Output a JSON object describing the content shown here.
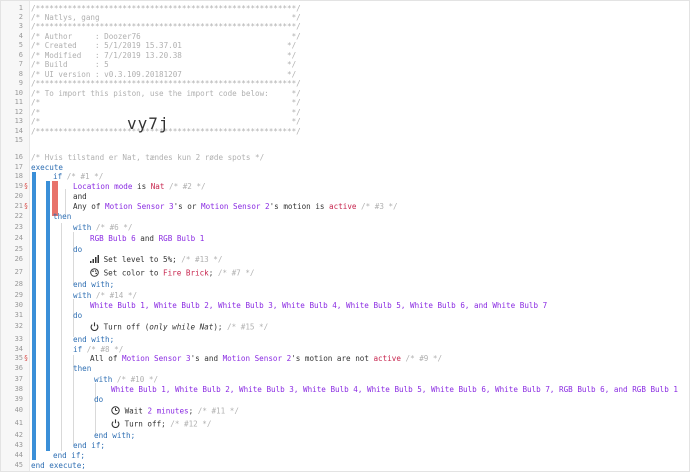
{
  "header": {
    "rule": "/*********************************************************/",
    "title": "/* Natlys, gang                                          */",
    "author": "/* Author     : Doozer76                                 */",
    "created": "/* Created    : 5/1/2019 15.37.01                       */",
    "modified": "/* Modified   : 7/1/2019 13.20.38                       */",
    "build": "/* Build      : 5                                       */",
    "ui_version": "/* UI version : v0.3.109.20181207                       */",
    "import_note": "/* To import this piston, use the import code below:     */",
    "blank": "/*                                                       */",
    "blank_pad": "/*                                                       */",
    "import_code": "vy7j"
  },
  "code": {
    "comment_16": "/* Hvis tilstand er Nat, tændes kun 2 røde spots */",
    "execute": "execute",
    "if1_kw": "if",
    "if1_cm": "/* #1 */",
    "cond1_a": "Location mode",
    "cond1_b": " is ",
    "cond1_c": "Nat",
    "cond1_cm": " /* #2 */",
    "and": "and",
    "cond2_a": "Any of ",
    "cond2_b": "Motion Sensor 3",
    "cond2_c": "'s or ",
    "cond2_d": "Motion Sensor 2",
    "cond2_e": "'s motion is ",
    "cond2_f": "active",
    "cond2_cm": " /* #3 */",
    "then": "then",
    "with": "with",
    "with6_cm": " /* #6 */",
    "rgb_a": "RGB Bulb 6",
    "rgb_and": " and ",
    "rgb_b": "RGB Bulb 1",
    "do": "do",
    "set_level": "Set level to 5%;",
    "set_level_cm": " /* #13 */",
    "set_color_a": "Set color to ",
    "set_color_b": "Fire Brick",
    "set_color_c": ";",
    "set_color_cm": " /* #7 */",
    "end_with": "end with;",
    "with14_cm": " /* #14 */",
    "white_list": "White Bulb 1, White Bulb 2, White Bulb 3, White Bulb 4, White Bulb 5, White Bulb 6, and White Bulb 7",
    "turn_off_a": "Turn off (",
    "turn_off_b": "only while Nat",
    "turn_off_c": ");",
    "turn_off_cm": " /* #15 */",
    "if8_cm": " /* #8 */",
    "cond9_a": "All of ",
    "cond9_b": "Motion Sensor 3",
    "cond9_c": "'s and ",
    "cond9_d": "Motion Sensor 2",
    "cond9_e": "'s motion are not ",
    "cond9_f": "active",
    "cond9_cm": " /* #9 */",
    "with10_cm": " /* #10 */",
    "white_rgb_list": "White Bulb 1, White Bulb 2, White Bulb 3, White Bulb 4, White Bulb 5, White Bulb 6, White Bulb 7, RGB Bulb 6, and RGB Bulb 1",
    "wait_a": "Wait ",
    "wait_b": "2 minutes",
    "wait_c": ";",
    "wait_cm": " /* #11 */",
    "turn_off2": "Turn off;",
    "turn_off2_cm": " /* #12 */",
    "end_if": "end if;",
    "end_execute": "end execute;"
  },
  "line_numbers": [
    "1",
    "2",
    "3",
    "4",
    "5",
    "6",
    "7",
    "8",
    "9",
    "10",
    "11",
    "12",
    "13",
    "14",
    "15",
    "16",
    "17",
    "18",
    "19",
    "20",
    "21",
    "22",
    "23",
    "24",
    "25",
    "26",
    "27",
    "28",
    "29",
    "30",
    "31",
    "32",
    "33",
    "34",
    "35",
    "36",
    "37",
    "38",
    "39",
    "40",
    "41",
    "42",
    "43",
    "44",
    "45"
  ],
  "flag_lines": [
    "19",
    "21",
    "35"
  ],
  "flag_icon": "stop-flag-icon",
  "colors": {
    "keyword": "#2f6fb3",
    "device": "#8a2be2",
    "value": "#c7254e",
    "comment": "#b0b0b0",
    "blue_bar": "#3a8fd8",
    "red_bar": "#e8736b"
  }
}
